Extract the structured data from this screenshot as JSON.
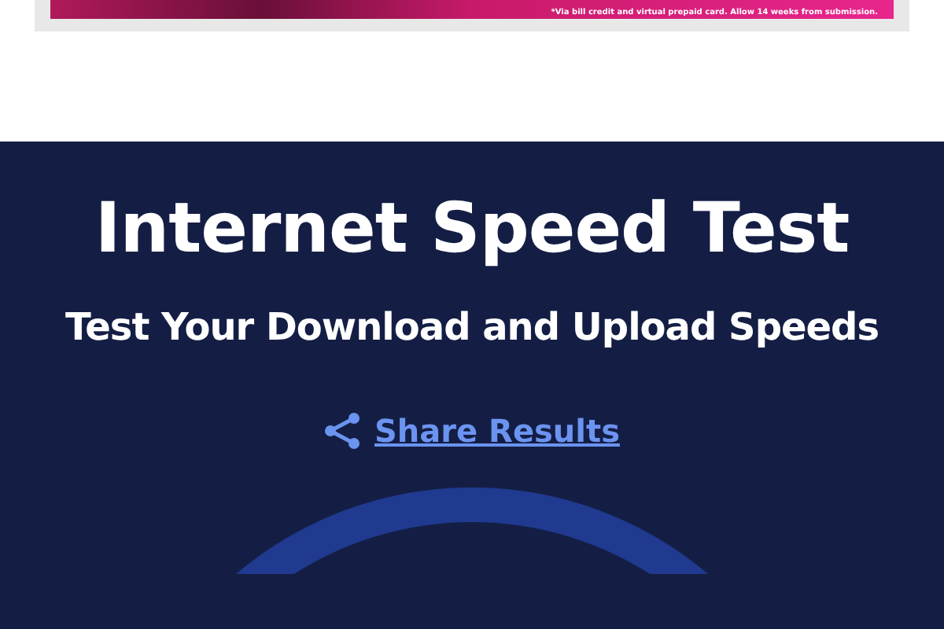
{
  "ad_banner": {
    "disclaimer": "*Via bill credit and virtual prepaid card. Allow 14 weeks from submission."
  },
  "hero": {
    "title": "Internet Speed Test",
    "subtitle": "Test Your Download and Upload Speeds",
    "share_link": "Share Results"
  }
}
